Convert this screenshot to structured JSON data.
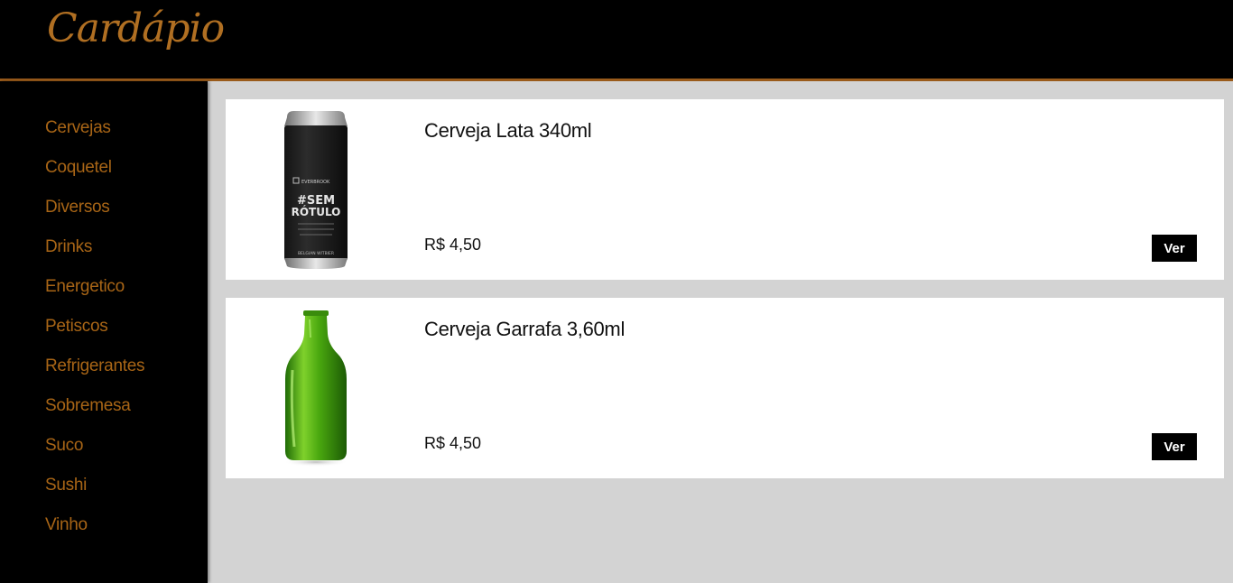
{
  "header": {
    "brand": "Cardápio",
    "accent_color": "#b06f22"
  },
  "sidebar": {
    "items": [
      {
        "label": "Cervejas"
      },
      {
        "label": "Coquetel"
      },
      {
        "label": "Diversos"
      },
      {
        "label": "Drinks"
      },
      {
        "label": "Energetico"
      },
      {
        "label": "Petiscos"
      },
      {
        "label": "Refrigerantes"
      },
      {
        "label": "Sobremesa"
      },
      {
        "label": "Suco"
      },
      {
        "label": "Sushi"
      },
      {
        "label": "Vinho"
      }
    ]
  },
  "products": [
    {
      "name": "Cerveja Lata 340ml",
      "price": "R$ 4,50",
      "button": "Ver",
      "image": "beer-can-image",
      "image_text": {
        "brand": "EVERBROOK",
        "line1": "#SEM",
        "line2": "RÓTULO",
        "style": "BELGIAN WITBIER"
      }
    },
    {
      "name": "Cerveja Garrafa 3,60ml",
      "price": "R$ 4,50",
      "button": "Ver",
      "image": "green-beer-bottle-image"
    }
  ]
}
